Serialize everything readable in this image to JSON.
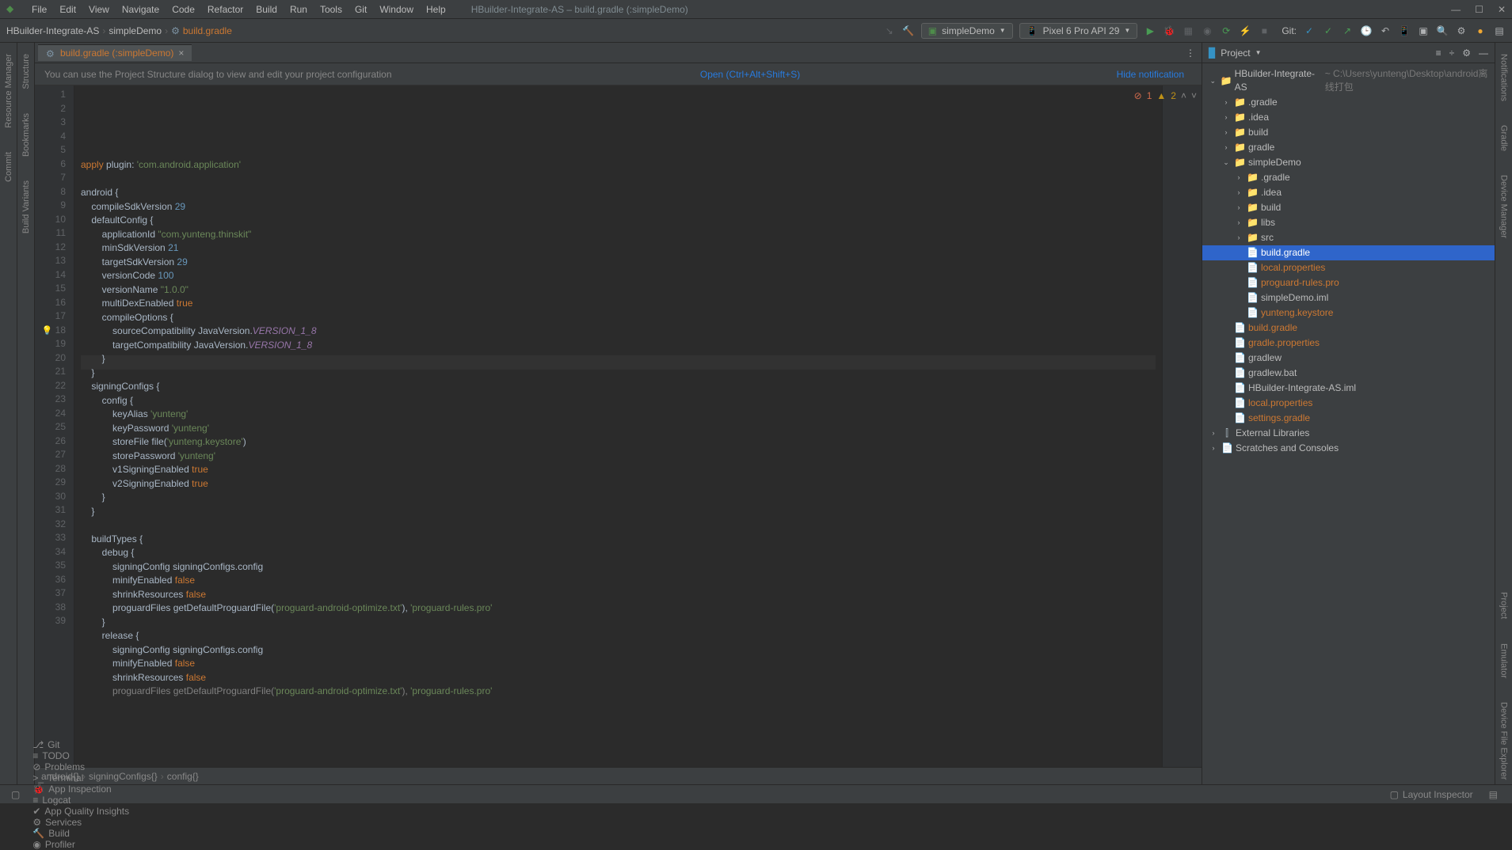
{
  "window": {
    "title": "HBuilder-Integrate-AS – build.gradle (:simpleDemo)",
    "minimize": "—",
    "maximize": "☐",
    "close": "✕"
  },
  "menu": [
    "File",
    "Edit",
    "View",
    "Navigate",
    "Code",
    "Refactor",
    "Build",
    "Run",
    "Tools",
    "Git",
    "Window",
    "Help"
  ],
  "breadcrumbs": {
    "items": [
      "HBuilder-Integrate-AS",
      "simpleDemo",
      "build.gradle"
    ],
    "last_hi": true
  },
  "run_config": {
    "module": "simpleDemo",
    "device": "Pixel 6 Pro API 29",
    "git_label": "Git:"
  },
  "tab": {
    "name": "build.gradle (:simpleDemo)"
  },
  "banner": {
    "text": "You can use the Project Structure dialog to view and edit your project configuration",
    "open": "Open (Ctrl+Alt+Shift+S)",
    "hide": "Hide notification"
  },
  "inspection": {
    "errors": "1",
    "warnings": "2"
  },
  "code_lines": [
    {
      "n": 1,
      "html": "<span class='kw'>apply</span> <span class='id'>plugin</span><span class='plain'>: </span><span class='str'>'com.android.application'</span>"
    },
    {
      "n": 2,
      "html": ""
    },
    {
      "n": 3,
      "html": "<span class='id'>android</span> <span class='plain'>{</span>"
    },
    {
      "n": 4,
      "html": "    <span class='id'>compileSdkVersion</span> <span class='num'>29</span>"
    },
    {
      "n": 5,
      "html": "    <span class='id'>defaultConfig</span> <span class='plain'>{</span>"
    },
    {
      "n": 6,
      "html": "        <span class='id'>applicationId</span> <span class='str'>\"com.yunteng.thinskit\"</span>"
    },
    {
      "n": 7,
      "html": "        <span class='id'>minSdkVersion</span> <span class='num'>21</span>"
    },
    {
      "n": 8,
      "html": "        <span class='id'>targetSdkVersion</span> <span class='num'>29</span>"
    },
    {
      "n": 9,
      "html": "        <span class='id'>versionCode</span> <span class='num'>100</span>"
    },
    {
      "n": 10,
      "html": "        <span class='id'>versionName</span> <span class='str'>\"1.0.0\"</span>"
    },
    {
      "n": 11,
      "html": "        <span class='id'>multiDexEnabled</span> <span class='kw'>true</span>"
    },
    {
      "n": 12,
      "html": "        <span class='id'>compileOptions</span> <span class='plain'>{</span>"
    },
    {
      "n": 13,
      "html": "            <span class='id'>sourceCompatibility</span> <span class='plain'>JavaVersion.</span><span class='const'>VERSION_1_8</span>"
    },
    {
      "n": 14,
      "html": "            <span class='id'>targetCompatibility</span> <span class='plain'>JavaVersion.</span><span class='const'>VERSION_1_8</span>"
    },
    {
      "n": 15,
      "html": "        <span class='plain'>}</span>"
    },
    {
      "n": 16,
      "html": "    <span class='plain'>}</span>"
    },
    {
      "n": 17,
      "html": "    <span class='id'>signingConfigs</span> <span class='plain'>{</span>"
    },
    {
      "n": 18,
      "html": "        <span class='id'>config</span> <span class='plain'>{</span>",
      "bulb": true
    },
    {
      "n": 19,
      "html": "            <span class='id'>keyAlias</span> <span class='str'>'yunteng'</span>"
    },
    {
      "n": 20,
      "html": "            <span class='id'>keyPassword</span> <span class='str'>'yunteng'</span>"
    },
    {
      "n": 21,
      "html": "            <span class='id'>storeFile</span> <span class='id'>file</span><span class='plain'>(</span><span class='str'>'yunteng.keystore'</span><span class='plain'>)</span>"
    },
    {
      "n": 22,
      "html": "            <span class='id'>storePassword</span> <span class='str'>'yunteng'</span>"
    },
    {
      "n": 23,
      "html": "            <span class='id'>v1SigningEnabled</span> <span class='kw'>true</span>"
    },
    {
      "n": 24,
      "html": "            <span class='id'>v2SigningEnabled</span> <span class='kw'>true</span>"
    },
    {
      "n": 25,
      "html": "        <span class='plain'>}</span>"
    },
    {
      "n": 26,
      "html": "    <span class='plain'>}</span>"
    },
    {
      "n": 27,
      "html": ""
    },
    {
      "n": 28,
      "html": "    <span class='id'>buildTypes</span> <span class='plain'>{</span>"
    },
    {
      "n": 29,
      "html": "        <span class='id'>debug</span> <span class='plain'>{</span>"
    },
    {
      "n": 30,
      "html": "            <span class='id'>signingConfig</span> <span class='plain'>signingConfigs.config</span>"
    },
    {
      "n": 31,
      "html": "            <span class='id'>minifyEnabled</span> <span class='kw'>false</span>"
    },
    {
      "n": 32,
      "html": "            <span class='id'>shrinkResources</span> <span class='kw'>false</span>"
    },
    {
      "n": 33,
      "html": "            <span class='id'>proguardFiles</span> <span class='id'>getDefaultProguardFile</span><span class='plain'>(</span><span class='str'>'proguard-android-optimize.txt'</span><span class='plain'>), </span><span class='str'>'proguard-rules.pro'</span>"
    },
    {
      "n": 34,
      "html": "        <span class='plain'>}</span>"
    },
    {
      "n": 35,
      "html": "        <span class='id'>release</span> <span class='plain'>{</span>"
    },
    {
      "n": 36,
      "html": "            <span class='id'>signingConfig</span> <span class='plain'>signingConfigs.config</span>"
    },
    {
      "n": 37,
      "html": "            <span class='id'>minifyEnabled</span> <span class='kw'>false</span>"
    },
    {
      "n": 38,
      "html": "            <span class='id'>shrinkResources</span> <span class='kw'>false</span>"
    },
    {
      "n": 39,
      "html": "            <span class='dimline'>proguardFiles getDefaultProguardFile(</span><span class='str'>'proguard-android-optimize.txt'</span><span class='dimline'>), </span><span class='str'>'proguard-rules.pro'</span>"
    }
  ],
  "crumbbar": [
    "android{}",
    "signingConfigs{}",
    "config{}"
  ],
  "project_header": {
    "title": "Project"
  },
  "project_tree": [
    {
      "d": 0,
      "exp": "v",
      "ico": "folder",
      "nm": "HBuilder-Integrate-AS",
      "path": "~ C:\\Users\\yunteng\\Desktop\\android离线打包"
    },
    {
      "d": 1,
      "exp": ">",
      "ico": "folder-o",
      "nm": ".gradle"
    },
    {
      "d": 1,
      "exp": ">",
      "ico": "folder",
      "nm": ".idea"
    },
    {
      "d": 1,
      "exp": ">",
      "ico": "folder-o",
      "nm": "build"
    },
    {
      "d": 1,
      "exp": ">",
      "ico": "folder",
      "nm": "gradle"
    },
    {
      "d": 1,
      "exp": "v",
      "ico": "folder",
      "nm": "simpleDemo"
    },
    {
      "d": 2,
      "exp": ">",
      "ico": "folder-o",
      "nm": ".gradle"
    },
    {
      "d": 2,
      "exp": ">",
      "ico": "folder",
      "nm": ".idea"
    },
    {
      "d": 2,
      "exp": ">",
      "ico": "folder-o",
      "nm": "build"
    },
    {
      "d": 2,
      "exp": ">",
      "ico": "folder",
      "nm": "libs"
    },
    {
      "d": 2,
      "exp": ">",
      "ico": "folder",
      "nm": "src"
    },
    {
      "d": 2,
      "exp": "",
      "ico": "file",
      "nm": "build.gradle",
      "hi": true,
      "sel": true
    },
    {
      "d": 2,
      "exp": "",
      "ico": "file",
      "nm": "local.properties",
      "hi": true
    },
    {
      "d": 2,
      "exp": "",
      "ico": "file",
      "nm": "proguard-rules.pro",
      "hi": true
    },
    {
      "d": 2,
      "exp": "",
      "ico": "file",
      "nm": "simpleDemo.iml"
    },
    {
      "d": 2,
      "exp": "",
      "ico": "file",
      "nm": "yunteng.keystore",
      "hi": true
    },
    {
      "d": 1,
      "exp": "",
      "ico": "file",
      "nm": "build.gradle",
      "hi": true
    },
    {
      "d": 1,
      "exp": "",
      "ico": "file",
      "nm": "gradle.properties",
      "hi": true
    },
    {
      "d": 1,
      "exp": "",
      "ico": "file",
      "nm": "gradlew"
    },
    {
      "d": 1,
      "exp": "",
      "ico": "file",
      "nm": "gradlew.bat"
    },
    {
      "d": 1,
      "exp": "",
      "ico": "file",
      "nm": "HBuilder-Integrate-AS.iml"
    },
    {
      "d": 1,
      "exp": "",
      "ico": "file",
      "nm": "local.properties",
      "hi": true
    },
    {
      "d": 1,
      "exp": "",
      "ico": "file",
      "nm": "settings.gradle",
      "hi": true
    },
    {
      "d": 0,
      "exp": ">",
      "ico": "lib",
      "nm": "External Libraries"
    },
    {
      "d": 0,
      "exp": ">",
      "ico": "file",
      "nm": "Scratches and Consoles"
    }
  ],
  "left_sidebar": [
    "Resource Manager",
    "Commit"
  ],
  "right_sidebar_top": [
    "Notifications",
    "Gradle",
    "Device Manager"
  ],
  "right_sidebar_bottom": [
    "Project",
    "Emulator",
    "Device File Explorer"
  ],
  "status": {
    "left": [
      {
        "icon": "⎇",
        "label": "Git"
      },
      {
        "icon": "≡",
        "label": "TODO"
      },
      {
        "icon": "⊘",
        "label": "Problems"
      },
      {
        "icon": ">_",
        "label": "Terminal"
      },
      {
        "icon": "🐞",
        "label": "App Inspection"
      },
      {
        "icon": "≡",
        "label": "Logcat"
      },
      {
        "icon": "✔",
        "label": "App Quality Insights"
      },
      {
        "icon": "⚙",
        "label": "Services"
      },
      {
        "icon": "🔨",
        "label": "Build"
      },
      {
        "icon": "◉",
        "label": "Profiler"
      }
    ],
    "right": [
      "Layout Inspector"
    ]
  }
}
